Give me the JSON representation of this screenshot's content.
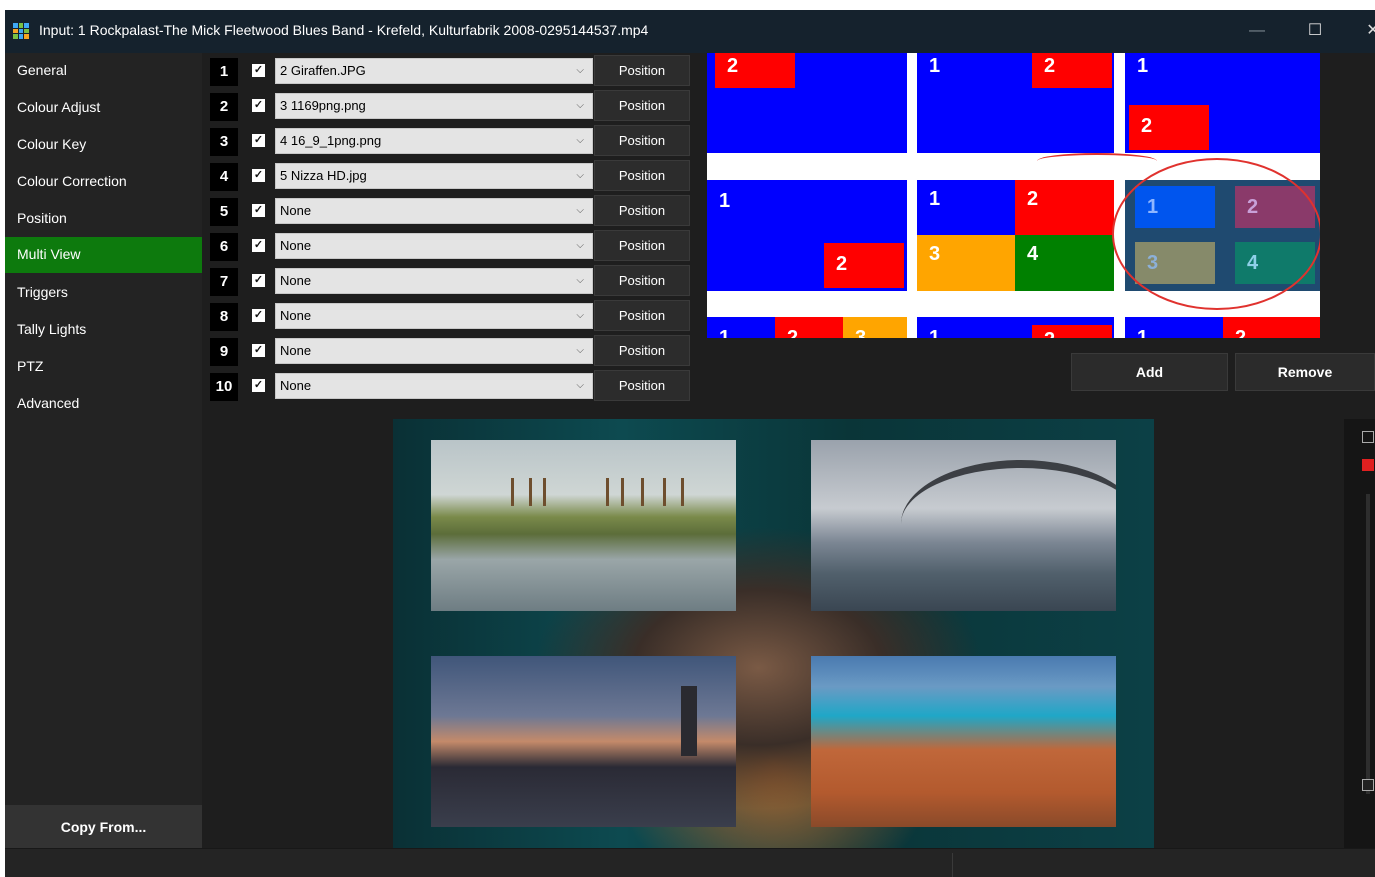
{
  "window": {
    "title": "Input: 1 Rockpalast-The Mick Fleetwood Blues Band - Krefeld, Kulturfabrik 2008-0295144537.mp4",
    "controls": {
      "minimize": "—",
      "maximize": "☐",
      "close": "✕"
    }
  },
  "sidebar": {
    "items": [
      {
        "label": "General"
      },
      {
        "label": "Colour Adjust"
      },
      {
        "label": "Colour Key"
      },
      {
        "label": "Colour Correction"
      },
      {
        "label": "Position"
      },
      {
        "label": "Multi View",
        "active": true
      },
      {
        "label": "Triggers"
      },
      {
        "label": "Tally Lights"
      },
      {
        "label": "PTZ"
      },
      {
        "label": "Advanced"
      }
    ],
    "copy_from": "Copy From..."
  },
  "layers": [
    {
      "num": "1",
      "checked": true,
      "value": "2 Giraffen.JPG",
      "button": "Position"
    },
    {
      "num": "2",
      "checked": true,
      "value": "3 1169png.png",
      "button": "Position"
    },
    {
      "num": "3",
      "checked": true,
      "value": "4 16_9_1png.png",
      "button": "Position"
    },
    {
      "num": "4",
      "checked": true,
      "value": "5 Nizza HD.jpg",
      "button": "Position"
    },
    {
      "num": "5",
      "checked": true,
      "value": "None",
      "button": "Position"
    },
    {
      "num": "6",
      "checked": true,
      "value": "None",
      "button": "Position"
    },
    {
      "num": "7",
      "checked": true,
      "value": "None",
      "button": "Position"
    },
    {
      "num": "8",
      "checked": true,
      "value": "None",
      "button": "Position"
    },
    {
      "num": "9",
      "checked": true,
      "value": "None",
      "button": "Position"
    },
    {
      "num": "10",
      "checked": true,
      "value": "None",
      "button": "Position"
    }
  ],
  "layout_presets": {
    "labels": [
      "1",
      "2",
      "3",
      "4"
    ],
    "colors": {
      "bg": "#0000ff",
      "l2": "#ff0000",
      "l3": "#ffa500",
      "l4": "#008000",
      "q1": "#0055ee",
      "q2": "#8a3a6a",
      "q3": "#868a6a",
      "q4": "#0f7a6a",
      "quad_bg": "#1f4a70"
    }
  },
  "actions": {
    "add": "Add",
    "remove": "Remove"
  },
  "preview": {
    "description_icons": [
      "giraffes-image",
      "sydney-bridge-image",
      "westminster-image",
      "nice-coast-image"
    ]
  }
}
